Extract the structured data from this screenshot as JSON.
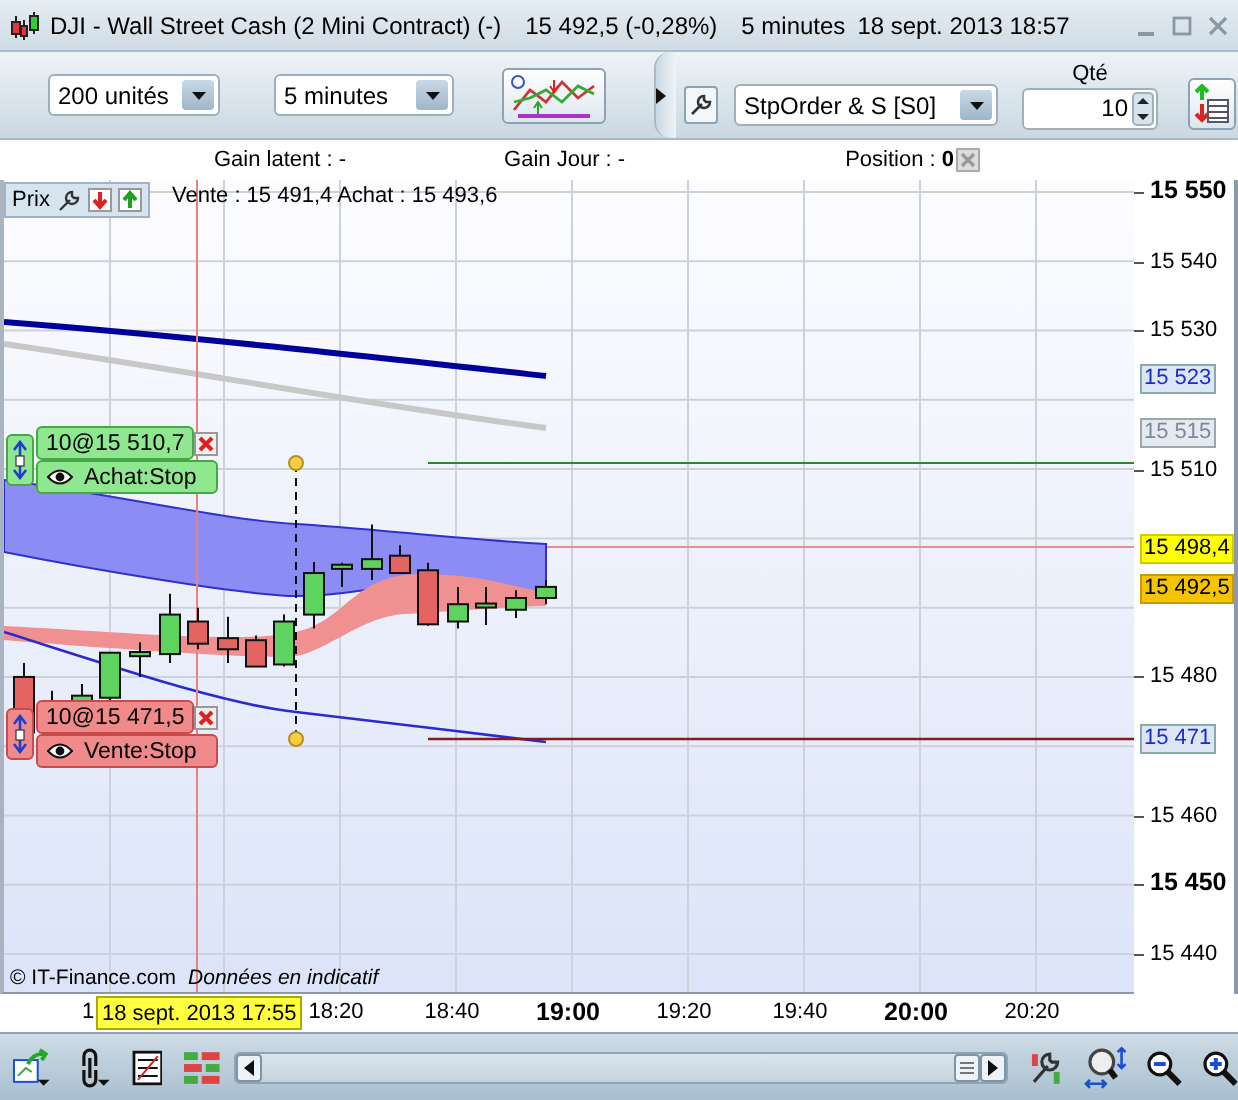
{
  "window": {
    "title": "DJI - Wall Street Cash (2 Mini Contract) (-)",
    "price": "15 492,5 (-0,28%)",
    "interval": "5 minutes",
    "datetime": "18 sept. 2013 18:57"
  },
  "toolbar": {
    "units": "200 unités",
    "period": "5 minutes",
    "order_type": "StpOrder & S [S0]",
    "quantity_label": "Qté",
    "quantity": "10"
  },
  "info_bar": {
    "gain_latent": "Gain latent : -",
    "gain_jour": "Gain Jour : -",
    "position_label": "Position :",
    "position_value": "0"
  },
  "chart": {
    "price_label": "Prix",
    "quote": "Vente : 15 491,4 Achat : 15 493,6",
    "orders": [
      {
        "kind": "buy",
        "amount": "10@15 510,7",
        "type": "Achat:Stop"
      },
      {
        "kind": "sell",
        "amount": "10@15 471,5",
        "type": "Vente:Stop"
      }
    ],
    "price_ticks": [
      {
        "label": "15 550",
        "major": true
      },
      {
        "label": "15 540",
        "major": false
      },
      {
        "label": "15 530",
        "major": false
      },
      {
        "label": "15 510",
        "major": false
      },
      {
        "label": "15 480",
        "major": false
      },
      {
        "label": "15 460",
        "major": false
      },
      {
        "label": "15 450",
        "major": true
      },
      {
        "label": "15 440",
        "major": false
      }
    ],
    "price_badges": [
      {
        "label": "15 523",
        "kind": "indicator"
      },
      {
        "label": "15 515",
        "kind": "faded"
      },
      {
        "label": "15 498,4",
        "kind": "ask"
      },
      {
        "label": "15 492,5",
        "kind": "last"
      },
      {
        "label": "15 471",
        "kind": "indicator"
      }
    ],
    "time_ticks": [
      {
        "label": "1",
        "kind": "partial",
        "major": false
      },
      {
        "label": "18:20",
        "kind": "full",
        "major": false
      },
      {
        "label": "18:40",
        "kind": "full",
        "major": false
      },
      {
        "label": "19:00",
        "kind": "full",
        "major": true
      },
      {
        "label": "19:20",
        "kind": "full",
        "major": false
      },
      {
        "label": "19:40",
        "kind": "full",
        "major": false
      },
      {
        "label": "20:00",
        "kind": "full",
        "major": true
      },
      {
        "label": "20:20",
        "kind": "full",
        "major": false
      }
    ],
    "cursor_time": "18 sept. 2013 17:55",
    "copyright": "© IT-Finance.com",
    "disclaimer": "Données en indicatif"
  }
}
